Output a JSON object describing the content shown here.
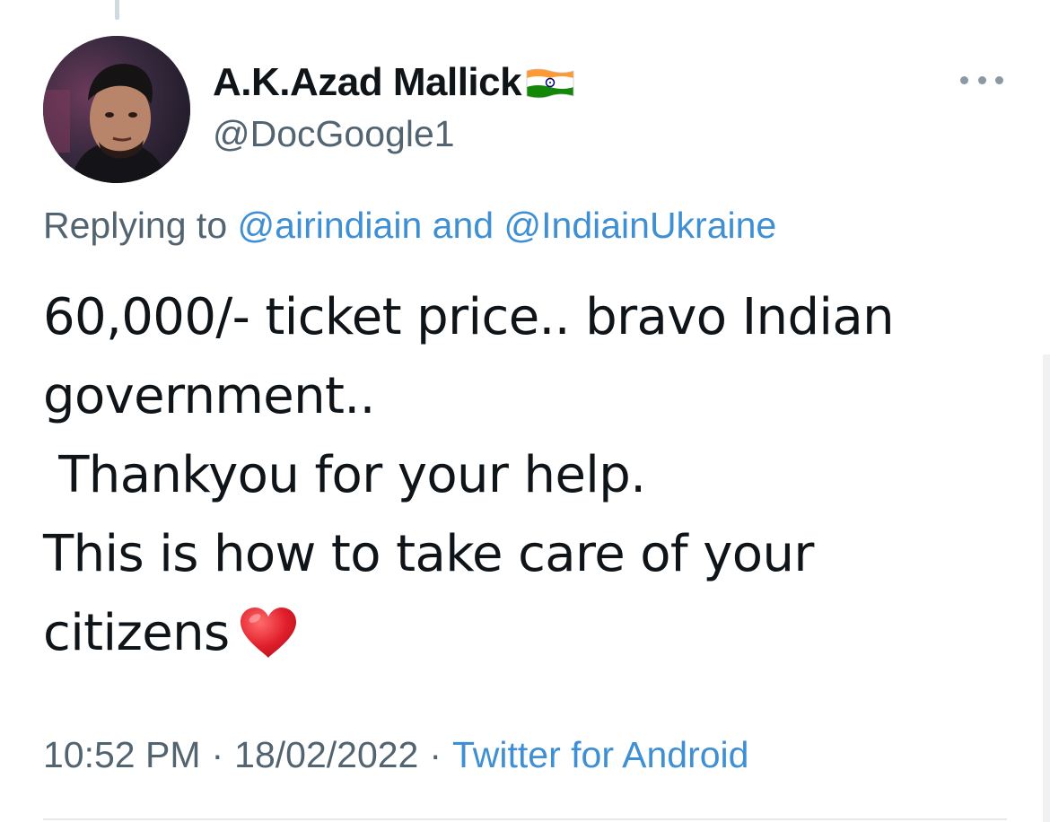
{
  "tweet": {
    "author": {
      "display_name": "A.K.Azad Mallick",
      "handle": "@DocGoogle1",
      "flag_icon": "india-flag-icon",
      "avatar": "profile-photo"
    },
    "more_icon": "more-horizontal-icon",
    "replying_to": {
      "prefix": "Replying to",
      "user_1": "@airindiain",
      "conjunction": "and",
      "user_2": "@IndiainUkraine"
    },
    "text_lines": [
      "60,000/- ticket price.. bravo Indian",
      "government..",
      " Thankyou for your help.",
      "This is how to take care of your",
      "citizens"
    ],
    "heart_emoji": "red-heart-emoji",
    "timestamp": {
      "time": "10:52 PM",
      "separator": "·",
      "date": "18/02/2022",
      "source": "Twitter for Android"
    },
    "colors": {
      "link": "#3e8fd3",
      "secondary_text": "#536471",
      "primary_text": "#0f1419"
    }
  }
}
